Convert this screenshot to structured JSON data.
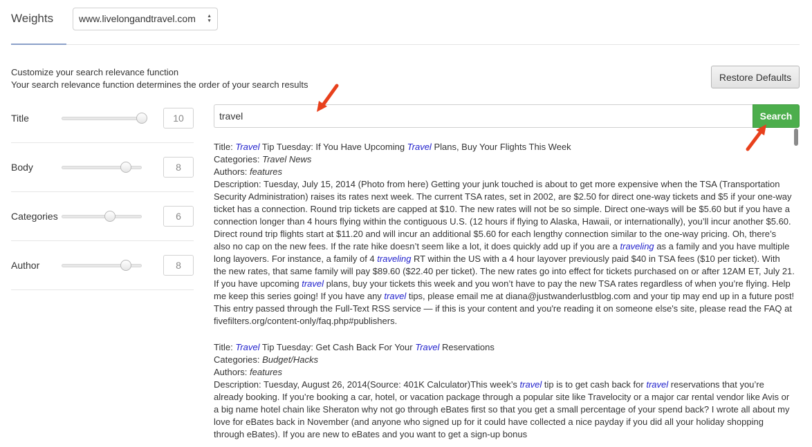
{
  "header": {
    "title": "Weights",
    "site_select": "www.livelongandtravel.com"
  },
  "intro": {
    "line1": "Customize your search relevance function",
    "line2": "Your search relevance function determines the order of your search results"
  },
  "restore_label": "Restore Defaults",
  "weights": [
    {
      "label": "Title",
      "value": "10",
      "fraction": 1.0
    },
    {
      "label": "Body",
      "value": "8",
      "fraction": 0.8
    },
    {
      "label": "Categories",
      "value": "6",
      "fraction": 0.6
    },
    {
      "label": "Author",
      "value": "8",
      "fraction": 0.8
    }
  ],
  "search": {
    "value": "travel",
    "button_label": "Search"
  },
  "results": [
    {
      "title_parts": [
        [
          "hl",
          "Travel"
        ],
        [
          "t",
          " Tip Tuesday: If You Have Upcoming "
        ],
        [
          "hl",
          "Travel"
        ],
        [
          "t",
          " Plans, Buy Your Flights This Week"
        ]
      ],
      "categories": "Travel News",
      "authors": "features",
      "description_parts": [
        [
          "t",
          "Tuesday, July 15, 2014 (Photo from here) Getting your junk touched is about to get more expensive when the TSA (Transportation Security Administration) raises its rates next week.  The current TSA rates, set in 2002, are $2.50 for direct one-way tickets and $5 if your one-way ticket has a connection.  Round trip tickets are capped at $10.  The new rates will not be so simple.  Direct one-ways will be $5.60 but if you have a connection longer than 4 hours flying within the contiguous U.S. (12 hours if flying to Alaska, Hawaii, or internationally), you’ll incur another $5.60.  Direct round trip flights start at $11.20 and will incur an additional $5.60 for each lengthy connection similar to the one-way pricing.  Oh, there’s also no cap on the new fees. If the rate hike doesn’t seem like a lot, it does quickly add up if you are a "
        ],
        [
          "hl",
          "traveling"
        ],
        [
          "t",
          " as a family and you have multiple long layovers.  For instance, a family of 4 "
        ],
        [
          "hl",
          "traveling"
        ],
        [
          "t",
          " RT within the US with a 4 hour layover previously paid $40 in TSA fees ($10 per ticket). With the new rates, that same family will pay $89.60 ($22.40 per ticket). The new rates go into effect for tickets purchased on or after 12AM ET, July 21.  If you have upcoming "
        ],
        [
          "hl",
          "travel"
        ],
        [
          "t",
          " plans, buy your tickets this week and you won’t have to pay the new TSA rates regardless of when you’re flying. Help me keep this series going!  If you have any "
        ],
        [
          "hl",
          "travel"
        ],
        [
          "t",
          " tips, please email me at diana@justwanderlustblog.com and your tip may end up in a future post! This entry passed through the Full-Text RSS service — if this is your content and you're reading it on someone else's site, please read the FAQ at fivefilters.org/content-only/faq.php#publishers."
        ]
      ]
    },
    {
      "title_parts": [
        [
          "hl",
          "Travel"
        ],
        [
          "t",
          " Tip Tuesday: Get Cash Back For Your "
        ],
        [
          "hl",
          "Travel"
        ],
        [
          "t",
          " Reservations"
        ]
      ],
      "categories": "Budget/Hacks",
      "authors": "features",
      "description_parts": [
        [
          "t",
          "Tuesday, August 26, 2014(Source: 401K Calculator)This week’s "
        ],
        [
          "hl",
          "travel"
        ],
        [
          "t",
          " tip is to get cash back for "
        ],
        [
          "hl",
          "travel"
        ],
        [
          "t",
          " reservations that you’re already booking.  If you’re booking a car, hotel, or vacation package through a popular site like Travelocity or a major car rental vendor like Avis or a big name hotel chain like Sheraton why not go through eBates first so that you get a small percentage of your spend back?  I wrote all about my love for eBates back in November (and anyone who signed up for it could have collected a nice payday if you did all your holiday shopping through eBates).  If you are new to eBates and you want to get a sign-up bonus"
        ]
      ]
    }
  ],
  "labels": {
    "title": "Title:",
    "categories": "Categories:",
    "authors": "Authors:",
    "description": "Description:"
  },
  "colors": {
    "accent_green": "#4cae4c",
    "highlight": "#2222cc",
    "annotation_arrow": "#e8401c"
  }
}
